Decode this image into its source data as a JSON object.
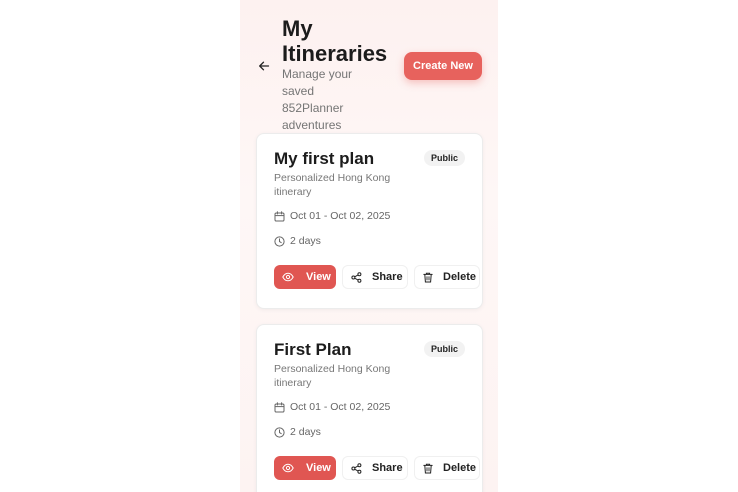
{
  "header": {
    "title": "My Itineraries",
    "subtitle": "Manage your saved 852Planner adventures",
    "create_label": "Create New",
    "back_icon": "arrow-left-icon"
  },
  "itineraries": [
    {
      "title": "My first plan",
      "visibility": "Public",
      "description": "Personalized Hong Kong itinerary",
      "dates": "Oct 01 - Oct 02, 2025",
      "duration": "2 days",
      "view_label": "View",
      "share_label": "Share",
      "delete_label": "Delete"
    },
    {
      "title": "First Plan",
      "visibility": "Public",
      "description": "Personalized Hong Kong itinerary",
      "dates": "Oct 01 - Oct 02, 2025",
      "duration": "2 days",
      "view_label": "View",
      "share_label": "Share",
      "delete_label": "Delete"
    }
  ],
  "icons": {
    "date": "calendar-icon",
    "duration": "clock-icon",
    "view": "eye-icon",
    "share": "share-icon",
    "delete": "trash-icon"
  },
  "colors": {
    "accent": "#e7625d",
    "view_button": "#e05652",
    "background": "#fdf1f0"
  }
}
